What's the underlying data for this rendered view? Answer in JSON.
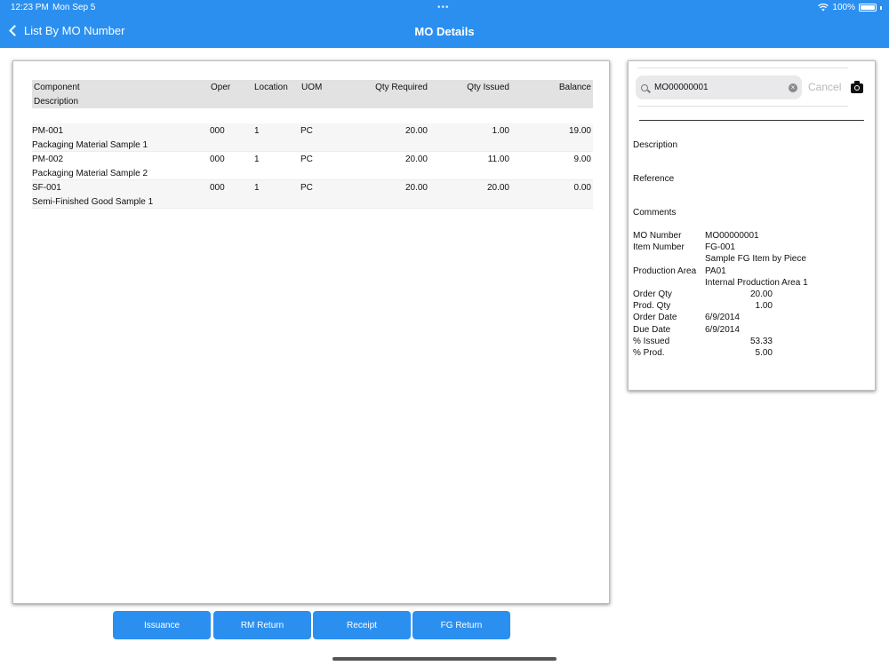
{
  "status": {
    "time": "12:23 PM",
    "date": "Mon Sep 5",
    "battery": "100%"
  },
  "nav": {
    "back_label": "List By MO Number",
    "title": "MO Details"
  },
  "table": {
    "headers": {
      "component": "Component",
      "description": "Description",
      "oper": "Oper",
      "location": "Location",
      "uom": "UOM",
      "qty_required": "Qty Required",
      "qty_issued": "Qty Issued",
      "balance": "Balance"
    },
    "rows": [
      {
        "component": "PM-001",
        "description": "Packaging Material Sample 1",
        "oper": "000",
        "location": "1",
        "uom": "PC",
        "qty_required": "20.00",
        "qty_issued": "1.00",
        "balance": "19.00"
      },
      {
        "component": "PM-002",
        "description": "Packaging Material Sample 2",
        "oper": "000",
        "location": "1",
        "uom": "PC",
        "qty_required": "20.00",
        "qty_issued": "11.00",
        "balance": "9.00"
      },
      {
        "component": "SF-001",
        "description": "Semi-Finished Good Sample 1",
        "oper": "000",
        "location": "1",
        "uom": "PC",
        "qty_required": "20.00",
        "qty_issued": "20.00",
        "balance": "0.00"
      }
    ]
  },
  "search": {
    "value": "MO00000001",
    "cancel_label": "Cancel"
  },
  "details": {
    "description_label": "Description",
    "reference_label": "Reference",
    "comments_label": "Comments",
    "mo_number_label": "MO Number",
    "mo_number": "MO00000001",
    "item_number_label": "Item Number",
    "item_number": "FG-001",
    "item_desc": "Sample FG Item by Piece",
    "production_area_label": "Production Area",
    "production_area": "PA01",
    "production_area_desc": "Internal Production Area 1",
    "order_qty_label": "Order Qty",
    "order_qty": "20.00",
    "prod_qty_label": "Prod. Qty",
    "prod_qty": "1.00",
    "order_date_label": "Order Date",
    "order_date": "6/9/2014",
    "due_date_label": "Due Date",
    "due_date": "6/9/2014",
    "pct_issued_label": "% Issued",
    "pct_issued": "53.33",
    "pct_prod_label": "% Prod.",
    "pct_prod": "5.00"
  },
  "buttons": {
    "issuance": "Issuance",
    "rm_return": "RM Return",
    "receipt": "Receipt",
    "fg_return": "FG Return"
  },
  "colors": {
    "accent": "#2b8ff0"
  }
}
